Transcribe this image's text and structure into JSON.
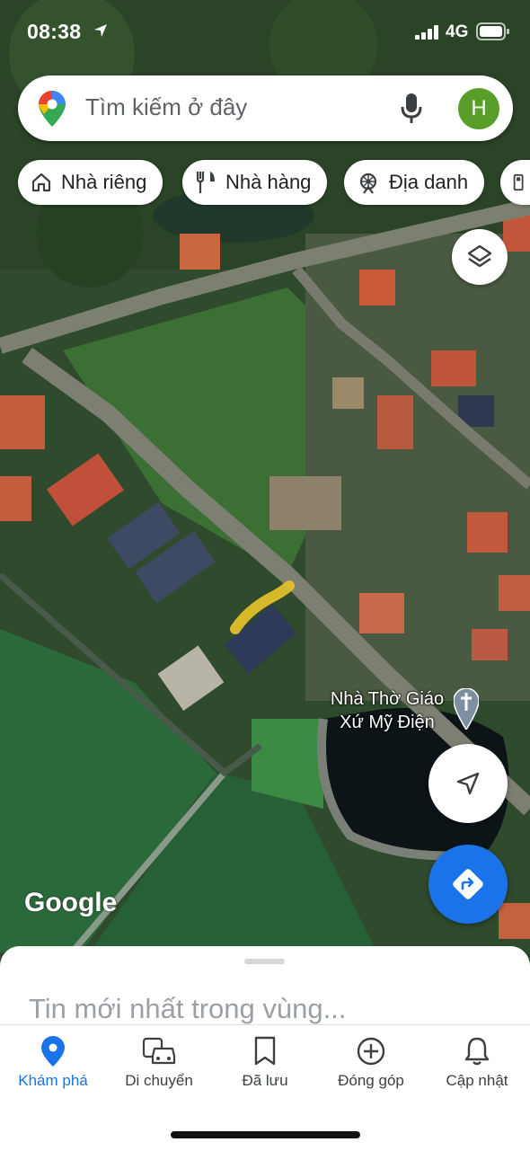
{
  "status_bar": {
    "time": "08:38",
    "network": "4G"
  },
  "search": {
    "placeholder": "Tìm kiếm ở đây",
    "avatar_initial": "H"
  },
  "chips": [
    {
      "label": "Nhà riêng",
      "icon": "home-icon"
    },
    {
      "label": "Nhà hàng",
      "icon": "restaurant-icon"
    },
    {
      "label": "Địa danh",
      "icon": "landmark-icon"
    },
    {
      "label": "",
      "icon": "gas-station-icon"
    }
  ],
  "map": {
    "poi_label": "Nhà Thờ Giáo Xứ Mỹ Điện",
    "poi_icon": "church-pin-icon",
    "attribution": "Google"
  },
  "sheet": {
    "title": "Tin mới nhất trong vùng..."
  },
  "bottom_nav": [
    {
      "label": "Khám phá",
      "icon": "explore-pin-icon",
      "active": true
    },
    {
      "label": "Di chuyển",
      "icon": "commute-icon",
      "active": false
    },
    {
      "label": "Đã lưu",
      "icon": "bookmark-icon",
      "active": false
    },
    {
      "label": "Đóng góp",
      "icon": "add-circle-icon",
      "active": false
    },
    {
      "label": "Cập nhật",
      "icon": "bell-icon",
      "active": false
    }
  ],
  "colors": {
    "accent": "#1a73e8",
    "avatar": "#5a9e2a",
    "highlight_stroke": "#e8c52a"
  }
}
